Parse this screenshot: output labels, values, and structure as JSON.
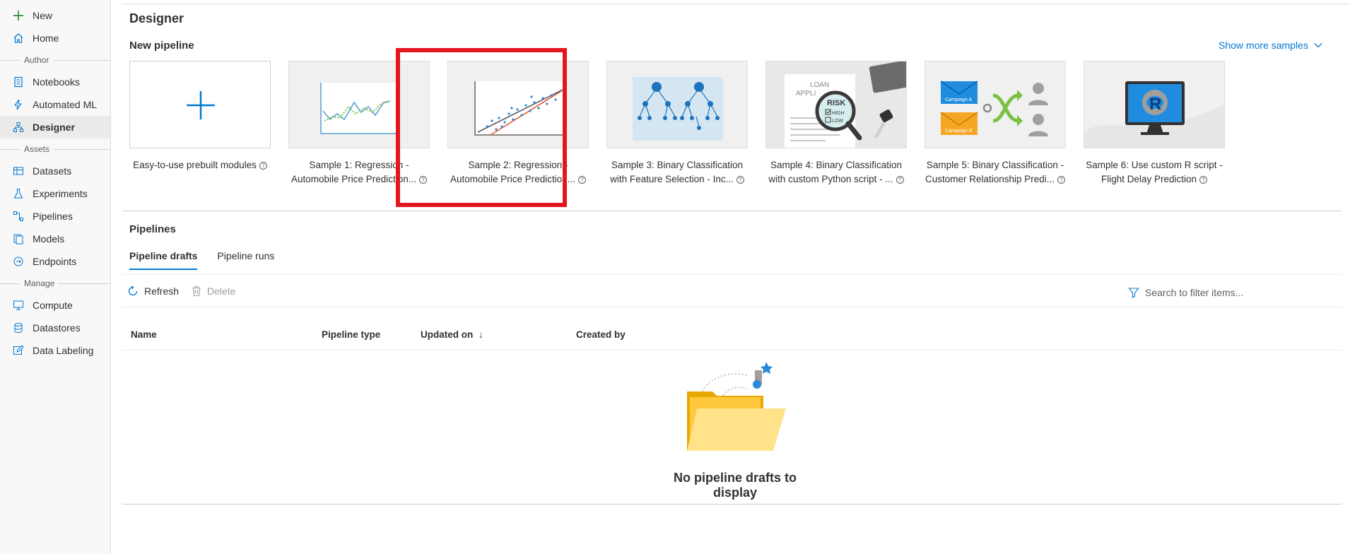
{
  "sidebar": {
    "new_label": "New",
    "home_label": "Home",
    "author_section": "Author",
    "notebooks_label": "Notebooks",
    "automl_label": "Automated ML",
    "designer_label": "Designer",
    "assets_section": "Assets",
    "datasets_label": "Datasets",
    "experiments_label": "Experiments",
    "pipelines_label": "Pipelines",
    "models_label": "Models",
    "endpoints_label": "Endpoints",
    "manage_section": "Manage",
    "compute_label": "Compute",
    "datastores_label": "Datastores",
    "datalabeling_label": "Data Labeling"
  },
  "page": {
    "title": "Designer",
    "new_pipeline_title": "New pipeline",
    "show_more": "Show more samples"
  },
  "cards": [
    {
      "line1": "Easy-to-use prebuilt modules",
      "line2": ""
    },
    {
      "line1": "Sample 1: Regression -",
      "line2": "Automobile Price Prediction..."
    },
    {
      "line1": "Sample 2: Regression -",
      "line2": "Automobile Price Prediction..."
    },
    {
      "line1": "Sample 3: Binary Classification",
      "line2": "with Feature Selection - Inc..."
    },
    {
      "line1": "Sample 4: Binary Classification",
      "line2": "with custom Python script - ..."
    },
    {
      "line1": "Sample 5: Binary Classification -",
      "line2": "Customer Relationship Predi..."
    },
    {
      "line1": "Sample 6: Use custom R script -",
      "line2": "Flight Delay Prediction"
    }
  ],
  "thumb_text": {
    "loan": "LOAN",
    "appli": "APPLI",
    "risk": "RISK",
    "high": "HIGH",
    "low": "LOW",
    "campaign_a": "Campaign A",
    "campaign_b": "Campaign B",
    "r_letter": "R"
  },
  "pipelines": {
    "title": "Pipelines",
    "tab_drafts": "Pipeline drafts",
    "tab_runs": "Pipeline runs",
    "refresh": "Refresh",
    "delete": "Delete",
    "search_placeholder": "Search to filter items...",
    "col_name": "Name",
    "col_type": "Pipeline type",
    "col_updated": "Updated on",
    "sort_arrow": "↓",
    "col_created": "Created by",
    "empty_message": "No pipeline drafts to display"
  },
  "colors": {
    "accent": "#0078d4",
    "highlight": "#e3151d",
    "folder": "#ffc83d"
  }
}
